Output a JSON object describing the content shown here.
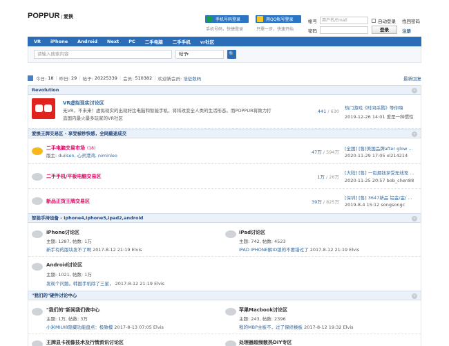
{
  "header": {
    "logo": "POPPUR",
    "logo_sep": "|",
    "logo_sub": "爱换",
    "phone_login": "手机号码登录",
    "phone_sub": "手机号码，快捷登录",
    "qq_login": "用QQ帐号登录",
    "qq_sub": "只需一步，快速开始",
    "account_label": "帐号",
    "account_placeholder": "用户名/Email",
    "password_label": "密码",
    "auto_login": "自动登录",
    "forgot_password": "找回密码",
    "login_button": "登录",
    "register": "注册"
  },
  "nav": [
    "VR",
    "iPhone",
    "Android",
    "Next",
    "PC",
    "二手电脑",
    "二手手机",
    "vr社区"
  ],
  "search": {
    "placeholder": "请输入搜索内容",
    "select": "帖子",
    "button": "🔍"
  },
  "stats": {
    "today_label": "今日:",
    "today": "18",
    "yesterday_label": "昨日:",
    "yesterday": "29",
    "posts_label": "帖子:",
    "posts": "20225339",
    "members_label": "会员:",
    "members": "510382",
    "welcome_label": "欢迎新会员:",
    "welcome_user": "浩征数码",
    "latest": "最新回复"
  },
  "sections": {
    "revolution": {
      "title": "Revolution",
      "forum": {
        "name": "VR虚拟现实讨论区",
        "desc1": "无VR，不未来！虚拟现实的出现好比电脑和智能手机，将将改变全人类的生活形态。而POPPUR将致力打",
        "desc2": "造国内最火最多玩家的VR社区",
        "count": "441",
        "total": "630",
        "last_title": "热门游戏《时间杀戮》等你嗨",
        "last_time": "2019-12-26 14:01 爱是一种惯性"
      }
    },
    "trade": {
      "title": "爱换王牌交易区 - 享受被秒快感，全网最速成交",
      "forums": [
        {
          "name": "二手电脑交易市场",
          "today": "(18)",
          "mods_label": "版主:",
          "mods": "duilsen, 心灵港湾, niminleo",
          "count": "47万",
          "total": "594万",
          "last_title": "[全国] [售]美国品牌after glow ...",
          "last_time": "2020-11-29 17:05 xl214214"
        },
        {
          "name": "二手手机/平板电脑交易区",
          "count": "1万",
          "total": "26万",
          "last_title": "[大陆] [售] 一包烟钱享受无线充 ...",
          "last_time": "2020-11-25 20:57 bob_chen88"
        },
        {
          "name": "新品正货王牌交易区",
          "count": "39万",
          "total": "825万",
          "last_title": "[深圳] [售] 3647新品 铝金/金/ ...",
          "last_time": "2019-8-4 15:12 songsongc"
        }
      ]
    },
    "mobile": {
      "title": "智能手持设备 - iphone4,iphone5,ipad2,android",
      "forums": [
        {
          "name": "iPhone讨论区",
          "stat": "主题: 1287, 帖数: 1万",
          "last_title": "新手有的版块发不了啊",
          "last_time": "2017-8-12 21:19 Elvis"
        },
        {
          "name": "iPad讨论区",
          "stat": "主题: 742, 帖数: 4523",
          "last_title": "IPAD IPHONE解ID锁的不要错过了",
          "last_time": "2017-8-12 21:19 Elvis"
        },
        {
          "name": "Android讨论区",
          "stat": "主题: 1021, 帖数: 1万",
          "last_title": "发现个问题。韩国手机除了三星，",
          "last_time": "2017-8-12 21:19 Elvis"
        }
      ]
    },
    "hardware": {
      "title": "\"我们的\"硬件讨论中心",
      "forums": [
        {
          "name": "\"我们的\"新闻我们做中心",
          "stat": "主题: 1万, 帖数: 3万",
          "last_title": "小米MIUI8隐藏功能盘点：极致模",
          "last_time": "2017-8-13 07:05 Elvis"
        },
        {
          "name": "苹果Macbook讨论区",
          "stat": "主题: 243, 帖数: 2396",
          "last_title": "我的MBP主板不，过了保修换板",
          "last_time": "2017-8-12 19:32 Elvis"
        },
        {
          "name": "王牌显卡视像技术及行情资讯讨论区"
        },
        {
          "name": "处理器超频散热DIY专区"
        }
      ]
    }
  },
  "colors": {
    "nav": "#2b6db7",
    "accent_red": "#e0005e",
    "link": "#336699"
  }
}
